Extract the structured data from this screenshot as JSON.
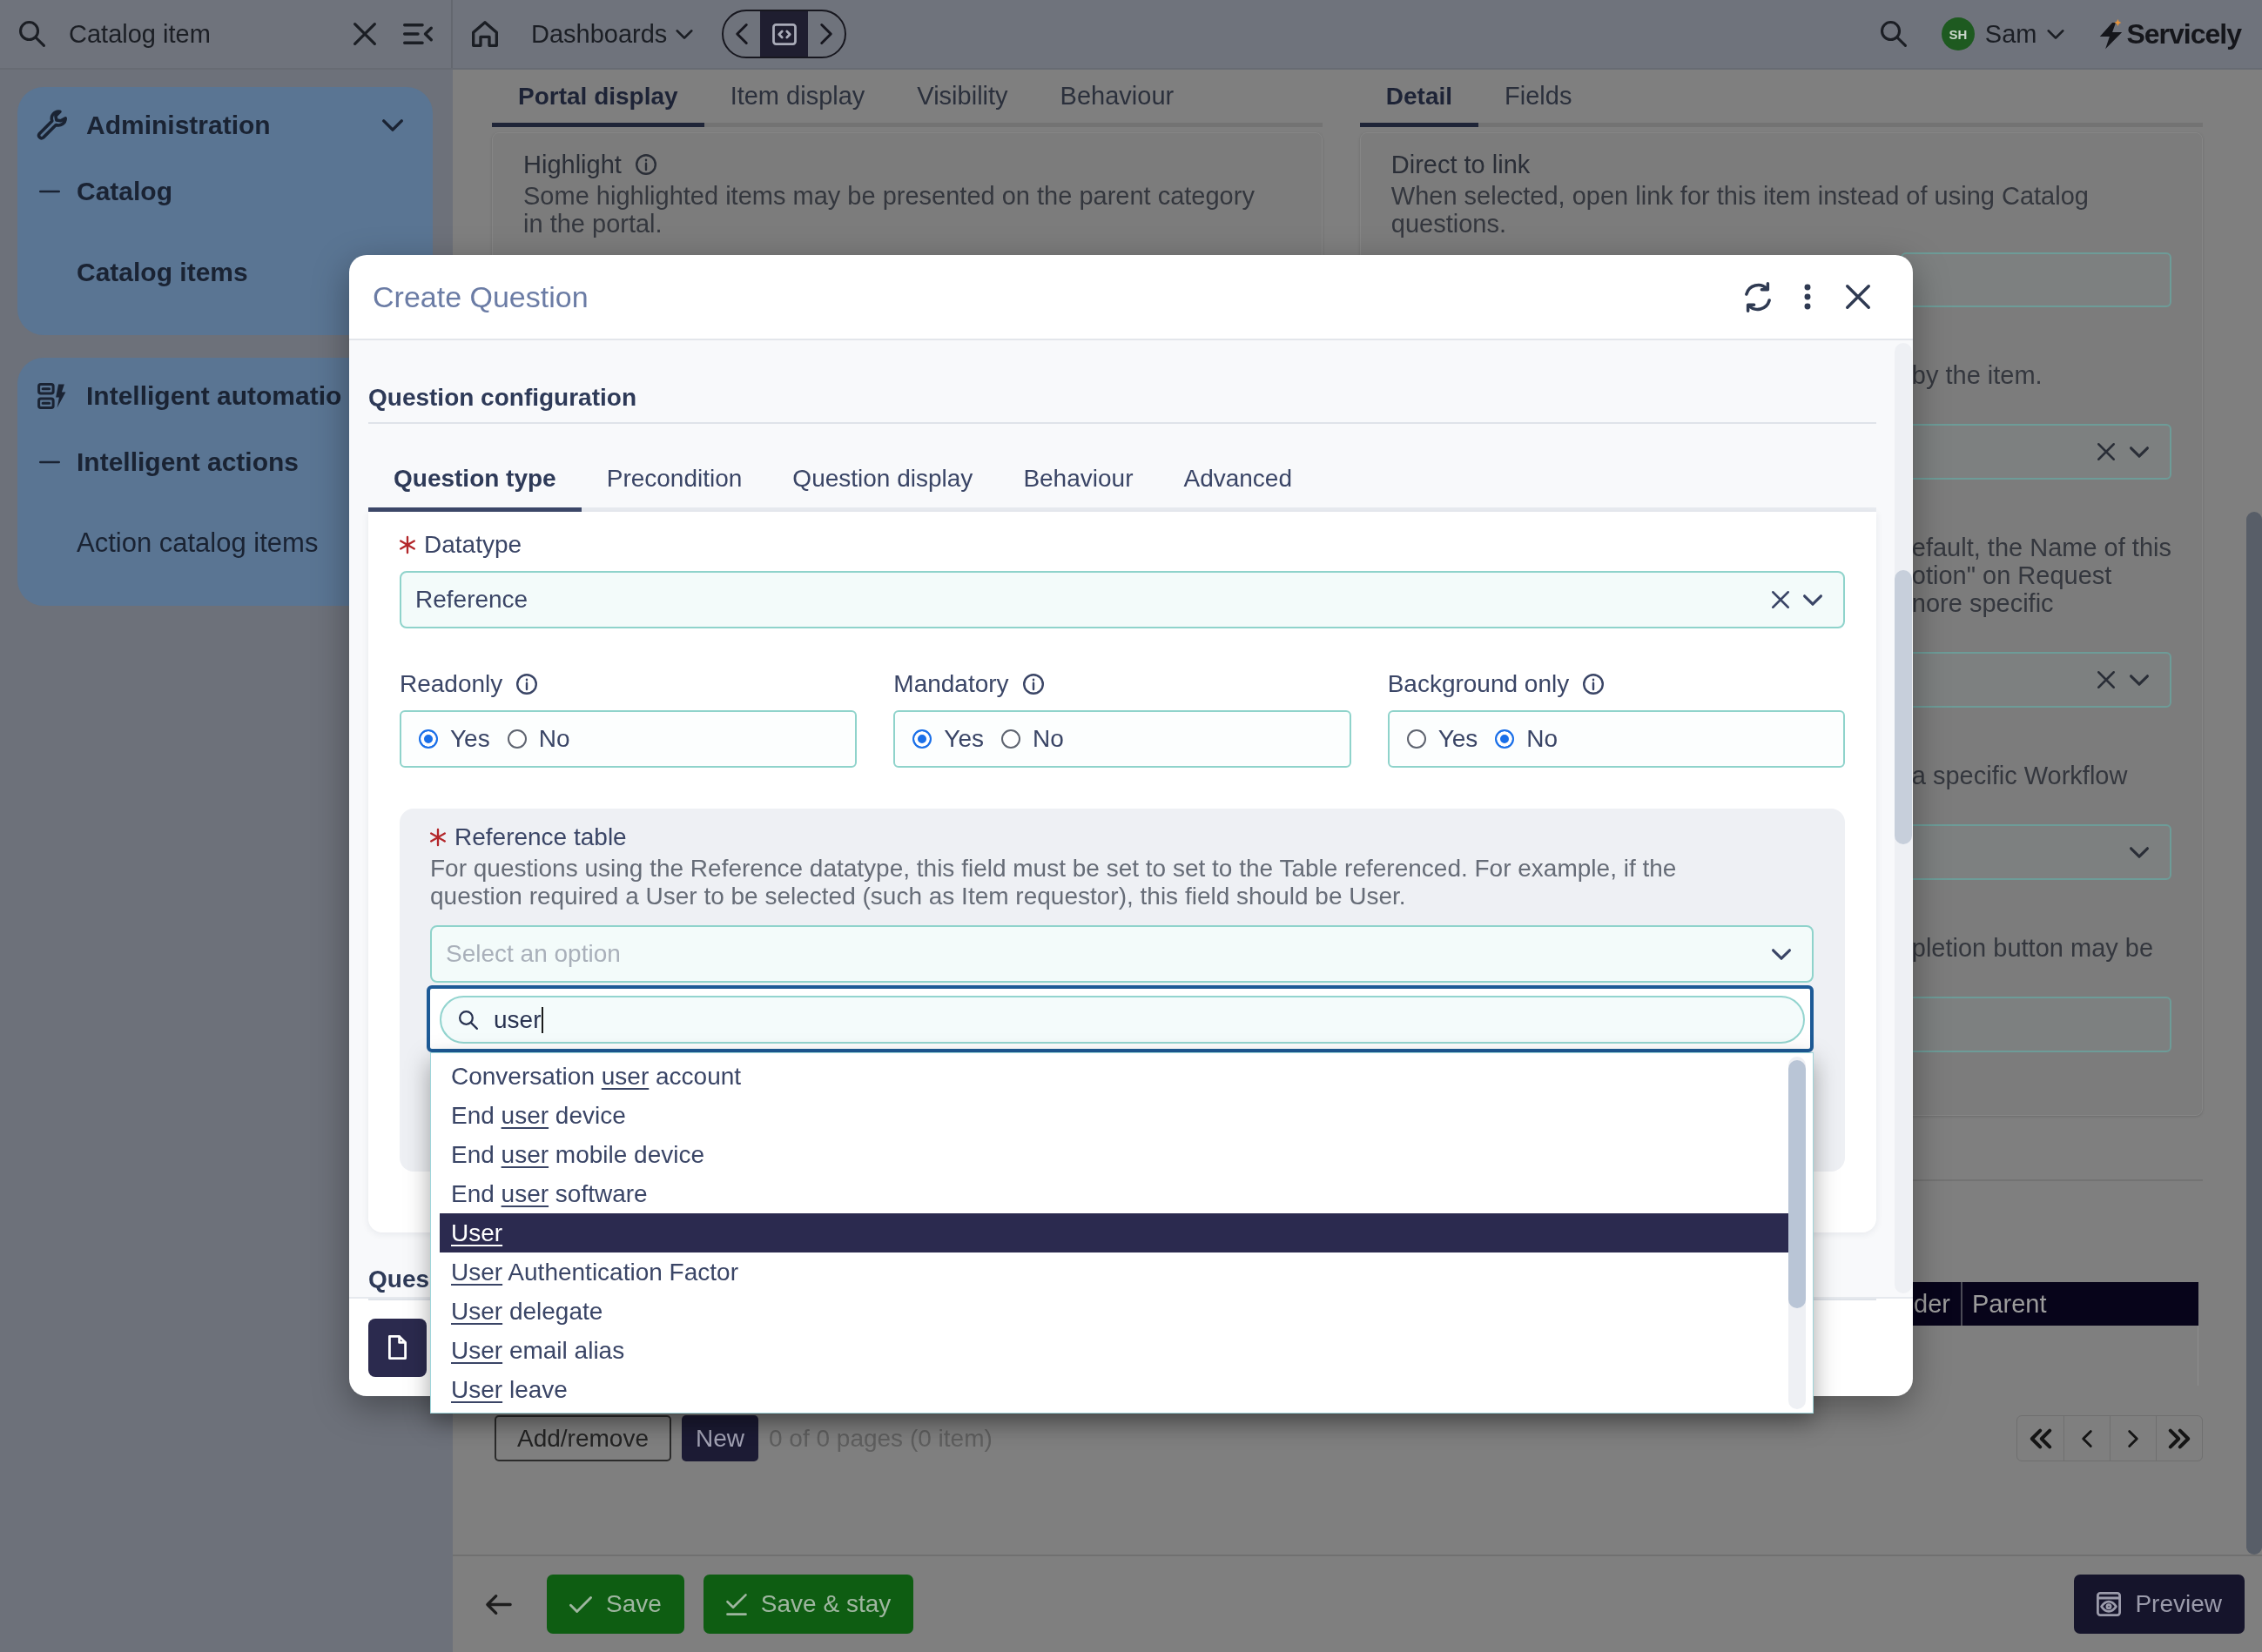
{
  "top_bar": {
    "search": {
      "value": "Catalog item"
    },
    "menu": "Dashboards",
    "user": {
      "initials": "SH",
      "name": "Sam"
    },
    "logo": "Servicely"
  },
  "sidebar": {
    "groups": [
      {
        "title": "Administration",
        "expanded": true,
        "children": [
          {
            "label": "Catalog",
            "expanded": true,
            "children": [
              {
                "label": "Catalog items",
                "selected": true
              }
            ]
          }
        ]
      },
      {
        "title": "Intelligent automatio",
        "children": [
          {
            "label": "Intelligent actions",
            "expanded": true,
            "children": [
              {
                "label": "Action catalog items",
                "selected": false
              }
            ]
          }
        ]
      }
    ]
  },
  "record": {
    "left_tabs": [
      {
        "label": "Portal display",
        "selected": true
      },
      {
        "label": "Item display",
        "selected": false
      },
      {
        "label": "Visibility",
        "selected": false
      },
      {
        "label": "Behaviour",
        "selected": false
      }
    ],
    "highlight": {
      "label": "Highlight",
      "description": "Some highlighted items may be presented on the parent category in the portal."
    },
    "right_tabs": [
      {
        "label": "Detail",
        "selected": true
      },
      {
        "label": "Fields",
        "selected": false
      }
    ],
    "fields": [
      {
        "label": "Direct to link",
        "description": "When selected, open link for this item instead of using Catalog questions.",
        "kind": "input"
      },
      {
        "hint_lines": [
          "by the item."
        ],
        "kind": "select",
        "clearable": true
      },
      {
        "hint_lines": [
          "efault, the Name of this",
          "otion\" on Request",
          "nore specific"
        ],
        "kind": "select",
        "clearable": true
      },
      {
        "hint_lines": [
          "a specific Workflow"
        ],
        "kind": "select",
        "clearable": false
      },
      {
        "hint_lines": [
          "pletion button may be"
        ],
        "kind": "input"
      }
    ],
    "related_list": {
      "columns": [
        "der",
        "Parent"
      ],
      "buttons": [
        {
          "label": "Add/remove",
          "kind": "add_remove"
        },
        {
          "label": "New",
          "kind": "new"
        }
      ],
      "page_info": "0 of 0 pages (0 item)"
    }
  },
  "footer": {
    "buttons": [
      {
        "label": "Save",
        "kind": "save"
      },
      {
        "label": "Save & stay",
        "kind": "save_stay"
      },
      {
        "label": "Preview",
        "kind": "preview"
      }
    ]
  },
  "dialog": {
    "title": "Create Question",
    "section": "Question configuration",
    "tabs": [
      {
        "label": "Question type",
        "selected": true
      },
      {
        "label": "Precondition",
        "selected": false
      },
      {
        "label": "Question display",
        "selected": false
      },
      {
        "label": "Behaviour",
        "selected": false
      },
      {
        "label": "Advanced",
        "selected": false
      }
    ],
    "datatype": {
      "label": "Datatype",
      "required": true,
      "value": "Reference"
    },
    "toggles": [
      {
        "label": "Readonly",
        "options": [
          {
            "label": "Yes",
            "selected": true
          },
          {
            "label": "No",
            "selected": false
          }
        ]
      },
      {
        "label": "Mandatory",
        "options": [
          {
            "label": "Yes",
            "selected": true
          },
          {
            "label": "No",
            "selected": false
          }
        ]
      },
      {
        "label": "Background only",
        "options": [
          {
            "label": "Yes",
            "selected": false
          },
          {
            "label": "No",
            "selected": true
          }
        ]
      }
    ],
    "reference_table": {
      "label": "Reference table",
      "required": true,
      "description": "For questions using the Reference datatype, this field must be set to set to the Table referenced. For example, if the question required a User to be selected (such as Item requestor), this field should be User.",
      "placeholder": "Select an option",
      "search": "user",
      "options": [
        {
          "prefix": "Conversation ",
          "match": "user",
          "suffix": " account",
          "selected": false
        },
        {
          "prefix": "End ",
          "match": "user",
          "suffix": " device",
          "selected": false
        },
        {
          "prefix": "End ",
          "match": "user",
          "suffix": " mobile device",
          "selected": false
        },
        {
          "prefix": "End ",
          "match": "user",
          "suffix": " software",
          "selected": false
        },
        {
          "match": "User",
          "selected": true
        },
        {
          "match": "User",
          "suffix": " Authentication Factor",
          "selected": false
        },
        {
          "match": "User",
          "suffix": " delegate",
          "selected": false
        },
        {
          "match": "User",
          "suffix": " email alias",
          "selected": false
        },
        {
          "match": "User",
          "suffix": " leave",
          "selected": false
        }
      ]
    },
    "next_section": "Ques"
  }
}
